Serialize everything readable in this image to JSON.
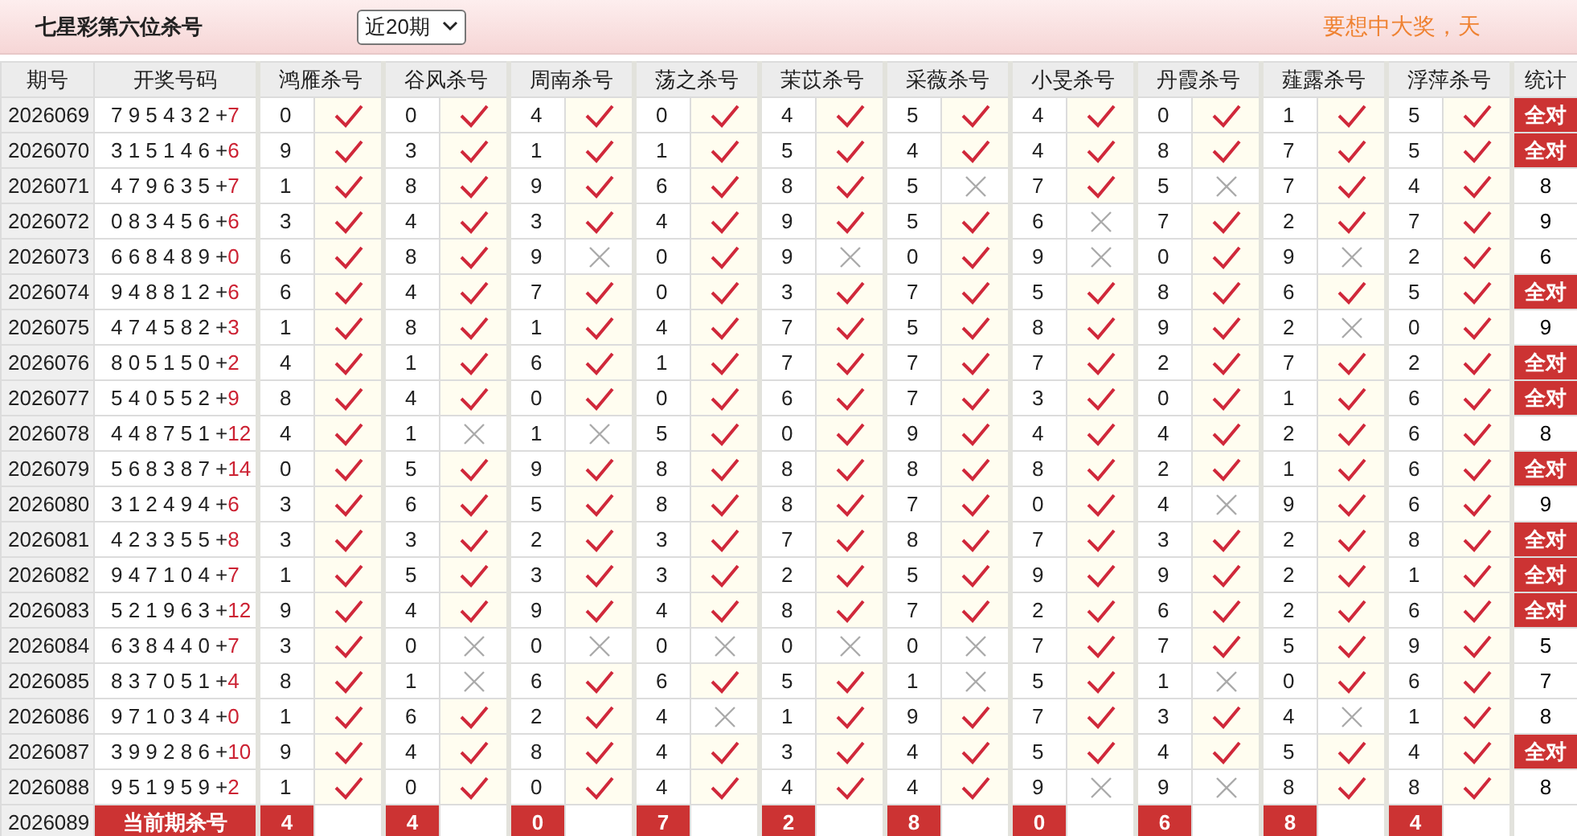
{
  "header": {
    "title": "七星彩第六位杀号",
    "period_select": {
      "value": "近20期"
    },
    "slogan": "要想中大奖，天"
  },
  "table": {
    "columns": [
      "期号",
      "开奖号码",
      "鸿雁杀号",
      "谷风杀号",
      "周南杀号",
      "荡之杀号",
      "茉苡杀号",
      "采薇杀号",
      "小旻杀号",
      "丹霞杀号",
      "薤露杀号",
      "浮萍杀号",
      "统计"
    ],
    "rows": [
      {
        "issue": "2026069",
        "draw": "7 9 5 4 3 2 +",
        "bonus": "7",
        "picks": [
          {
            "num": "0",
            "hit": true
          },
          {
            "num": "0",
            "hit": true
          },
          {
            "num": "4",
            "hit": true
          },
          {
            "num": "0",
            "hit": true
          },
          {
            "num": "4",
            "hit": true
          },
          {
            "num": "5",
            "hit": true
          },
          {
            "num": "4",
            "hit": true
          },
          {
            "num": "0",
            "hit": true
          },
          {
            "num": "1",
            "hit": true
          },
          {
            "num": "5",
            "hit": true
          }
        ],
        "stat": {
          "kind": "all",
          "text": "全对"
        }
      },
      {
        "issue": "2026070",
        "draw": "3 1 5 1 4 6 +",
        "bonus": "6",
        "picks": [
          {
            "num": "9",
            "hit": true
          },
          {
            "num": "3",
            "hit": true
          },
          {
            "num": "1",
            "hit": true
          },
          {
            "num": "1",
            "hit": true
          },
          {
            "num": "5",
            "hit": true
          },
          {
            "num": "4",
            "hit": true
          },
          {
            "num": "4",
            "hit": true
          },
          {
            "num": "8",
            "hit": true
          },
          {
            "num": "7",
            "hit": true
          },
          {
            "num": "5",
            "hit": true
          }
        ],
        "stat": {
          "kind": "all",
          "text": "全对"
        }
      },
      {
        "issue": "2026071",
        "draw": "4 7 9 6 3 5 +",
        "bonus": "7",
        "picks": [
          {
            "num": "1",
            "hit": true
          },
          {
            "num": "8",
            "hit": true
          },
          {
            "num": "9",
            "hit": true
          },
          {
            "num": "6",
            "hit": true
          },
          {
            "num": "8",
            "hit": true
          },
          {
            "num": "5",
            "hit": false
          },
          {
            "num": "7",
            "hit": true
          },
          {
            "num": "5",
            "hit": false
          },
          {
            "num": "7",
            "hit": true
          },
          {
            "num": "4",
            "hit": true
          }
        ],
        "stat": {
          "kind": "count",
          "text": "8"
        }
      },
      {
        "issue": "2026072",
        "draw": "0 8 3 4 5 6 +",
        "bonus": "6",
        "picks": [
          {
            "num": "3",
            "hit": true
          },
          {
            "num": "4",
            "hit": true
          },
          {
            "num": "3",
            "hit": true
          },
          {
            "num": "4",
            "hit": true
          },
          {
            "num": "9",
            "hit": true
          },
          {
            "num": "5",
            "hit": true
          },
          {
            "num": "6",
            "hit": false
          },
          {
            "num": "7",
            "hit": true
          },
          {
            "num": "2",
            "hit": true
          },
          {
            "num": "7",
            "hit": true
          }
        ],
        "stat": {
          "kind": "count",
          "text": "9"
        }
      },
      {
        "issue": "2026073",
        "draw": "6 6 8 4 8 9 +",
        "bonus": "0",
        "picks": [
          {
            "num": "6",
            "hit": true
          },
          {
            "num": "8",
            "hit": true
          },
          {
            "num": "9",
            "hit": false
          },
          {
            "num": "0",
            "hit": true
          },
          {
            "num": "9",
            "hit": false
          },
          {
            "num": "0",
            "hit": true
          },
          {
            "num": "9",
            "hit": false
          },
          {
            "num": "0",
            "hit": true
          },
          {
            "num": "9",
            "hit": false
          },
          {
            "num": "2",
            "hit": true
          }
        ],
        "stat": {
          "kind": "count",
          "text": "6"
        }
      },
      {
        "issue": "2026074",
        "draw": "9 4 8 8 1 2 +",
        "bonus": "6",
        "picks": [
          {
            "num": "6",
            "hit": true
          },
          {
            "num": "4",
            "hit": true
          },
          {
            "num": "7",
            "hit": true
          },
          {
            "num": "0",
            "hit": true
          },
          {
            "num": "3",
            "hit": true
          },
          {
            "num": "7",
            "hit": true
          },
          {
            "num": "5",
            "hit": true
          },
          {
            "num": "8",
            "hit": true
          },
          {
            "num": "6",
            "hit": true
          },
          {
            "num": "5",
            "hit": true
          }
        ],
        "stat": {
          "kind": "all",
          "text": "全对"
        }
      },
      {
        "issue": "2026075",
        "draw": "4 7 4 5 8 2 +",
        "bonus": "3",
        "picks": [
          {
            "num": "1",
            "hit": true
          },
          {
            "num": "8",
            "hit": true
          },
          {
            "num": "1",
            "hit": true
          },
          {
            "num": "4",
            "hit": true
          },
          {
            "num": "7",
            "hit": true
          },
          {
            "num": "5",
            "hit": true
          },
          {
            "num": "8",
            "hit": true
          },
          {
            "num": "9",
            "hit": true
          },
          {
            "num": "2",
            "hit": false
          },
          {
            "num": "0",
            "hit": true
          }
        ],
        "stat": {
          "kind": "count",
          "text": "9"
        }
      },
      {
        "issue": "2026076",
        "draw": "8 0 5 1 5 0 +",
        "bonus": "2",
        "picks": [
          {
            "num": "4",
            "hit": true
          },
          {
            "num": "1",
            "hit": true
          },
          {
            "num": "6",
            "hit": true
          },
          {
            "num": "1",
            "hit": true
          },
          {
            "num": "7",
            "hit": true
          },
          {
            "num": "7",
            "hit": true
          },
          {
            "num": "7",
            "hit": true
          },
          {
            "num": "2",
            "hit": true
          },
          {
            "num": "7",
            "hit": true
          },
          {
            "num": "2",
            "hit": true
          }
        ],
        "stat": {
          "kind": "all",
          "text": "全对"
        }
      },
      {
        "issue": "2026077",
        "draw": "5 4 0 5 5 2 +",
        "bonus": "9",
        "picks": [
          {
            "num": "8",
            "hit": true
          },
          {
            "num": "4",
            "hit": true
          },
          {
            "num": "0",
            "hit": true
          },
          {
            "num": "0",
            "hit": true
          },
          {
            "num": "6",
            "hit": true
          },
          {
            "num": "7",
            "hit": true
          },
          {
            "num": "3",
            "hit": true
          },
          {
            "num": "0",
            "hit": true
          },
          {
            "num": "1",
            "hit": true
          },
          {
            "num": "6",
            "hit": true
          }
        ],
        "stat": {
          "kind": "all",
          "text": "全对"
        }
      },
      {
        "issue": "2026078",
        "draw": "4 4 8 7 5 1 +",
        "bonus": "12",
        "picks": [
          {
            "num": "4",
            "hit": true
          },
          {
            "num": "1",
            "hit": false
          },
          {
            "num": "1",
            "hit": false
          },
          {
            "num": "5",
            "hit": true
          },
          {
            "num": "0",
            "hit": true
          },
          {
            "num": "9",
            "hit": true
          },
          {
            "num": "4",
            "hit": true
          },
          {
            "num": "4",
            "hit": true
          },
          {
            "num": "2",
            "hit": true
          },
          {
            "num": "6",
            "hit": true
          }
        ],
        "stat": {
          "kind": "count",
          "text": "8"
        }
      },
      {
        "issue": "2026079",
        "draw": "5 6 8 3 8 7 +",
        "bonus": "14",
        "picks": [
          {
            "num": "0",
            "hit": true
          },
          {
            "num": "5",
            "hit": true
          },
          {
            "num": "9",
            "hit": true
          },
          {
            "num": "8",
            "hit": true
          },
          {
            "num": "8",
            "hit": true
          },
          {
            "num": "8",
            "hit": true
          },
          {
            "num": "8",
            "hit": true
          },
          {
            "num": "2",
            "hit": true
          },
          {
            "num": "1",
            "hit": true
          },
          {
            "num": "6",
            "hit": true
          }
        ],
        "stat": {
          "kind": "all",
          "text": "全对"
        }
      },
      {
        "issue": "2026080",
        "draw": "3 1 2 4 9 4 +",
        "bonus": "6",
        "picks": [
          {
            "num": "3",
            "hit": true
          },
          {
            "num": "6",
            "hit": true
          },
          {
            "num": "5",
            "hit": true
          },
          {
            "num": "8",
            "hit": true
          },
          {
            "num": "8",
            "hit": true
          },
          {
            "num": "7",
            "hit": true
          },
          {
            "num": "0",
            "hit": true
          },
          {
            "num": "4",
            "hit": false
          },
          {
            "num": "9",
            "hit": true
          },
          {
            "num": "6",
            "hit": true
          }
        ],
        "stat": {
          "kind": "count",
          "text": "9"
        }
      },
      {
        "issue": "2026081",
        "draw": "4 2 3 3 5 5 +",
        "bonus": "8",
        "picks": [
          {
            "num": "3",
            "hit": true
          },
          {
            "num": "3",
            "hit": true
          },
          {
            "num": "2",
            "hit": true
          },
          {
            "num": "3",
            "hit": true
          },
          {
            "num": "7",
            "hit": true
          },
          {
            "num": "8",
            "hit": true
          },
          {
            "num": "7",
            "hit": true
          },
          {
            "num": "3",
            "hit": true
          },
          {
            "num": "2",
            "hit": true
          },
          {
            "num": "8",
            "hit": true
          }
        ],
        "stat": {
          "kind": "all",
          "text": "全对"
        }
      },
      {
        "issue": "2026082",
        "draw": "9 4 7 1 0 4 +",
        "bonus": "7",
        "picks": [
          {
            "num": "1",
            "hit": true
          },
          {
            "num": "5",
            "hit": true
          },
          {
            "num": "3",
            "hit": true
          },
          {
            "num": "3",
            "hit": true
          },
          {
            "num": "2",
            "hit": true
          },
          {
            "num": "5",
            "hit": true
          },
          {
            "num": "9",
            "hit": true
          },
          {
            "num": "9",
            "hit": true
          },
          {
            "num": "2",
            "hit": true
          },
          {
            "num": "1",
            "hit": true
          }
        ],
        "stat": {
          "kind": "all",
          "text": "全对"
        }
      },
      {
        "issue": "2026083",
        "draw": "5 2 1 9 6 3 +",
        "bonus": "12",
        "picks": [
          {
            "num": "9",
            "hit": true
          },
          {
            "num": "4",
            "hit": true
          },
          {
            "num": "9",
            "hit": true
          },
          {
            "num": "4",
            "hit": true
          },
          {
            "num": "8",
            "hit": true
          },
          {
            "num": "7",
            "hit": true
          },
          {
            "num": "2",
            "hit": true
          },
          {
            "num": "6",
            "hit": true
          },
          {
            "num": "2",
            "hit": true
          },
          {
            "num": "6",
            "hit": true
          }
        ],
        "stat": {
          "kind": "all",
          "text": "全对"
        }
      },
      {
        "issue": "2026084",
        "draw": "6 3 8 4 4 0 +",
        "bonus": "7",
        "picks": [
          {
            "num": "3",
            "hit": true
          },
          {
            "num": "0",
            "hit": false
          },
          {
            "num": "0",
            "hit": false
          },
          {
            "num": "0",
            "hit": false
          },
          {
            "num": "0",
            "hit": false
          },
          {
            "num": "0",
            "hit": false
          },
          {
            "num": "7",
            "hit": true
          },
          {
            "num": "7",
            "hit": true
          },
          {
            "num": "5",
            "hit": true
          },
          {
            "num": "9",
            "hit": true
          }
        ],
        "stat": {
          "kind": "count",
          "text": "5"
        }
      },
      {
        "issue": "2026085",
        "draw": "8 3 7 0 5 1 +",
        "bonus": "4",
        "picks": [
          {
            "num": "8",
            "hit": true
          },
          {
            "num": "1",
            "hit": false
          },
          {
            "num": "6",
            "hit": true
          },
          {
            "num": "6",
            "hit": true
          },
          {
            "num": "5",
            "hit": true
          },
          {
            "num": "1",
            "hit": false
          },
          {
            "num": "5",
            "hit": true
          },
          {
            "num": "1",
            "hit": false
          },
          {
            "num": "0",
            "hit": true
          },
          {
            "num": "6",
            "hit": true
          }
        ],
        "stat": {
          "kind": "count",
          "text": "7"
        }
      },
      {
        "issue": "2026086",
        "draw": "9 7 1 0 3 4 +",
        "bonus": "0",
        "picks": [
          {
            "num": "1",
            "hit": true
          },
          {
            "num": "6",
            "hit": true
          },
          {
            "num": "2",
            "hit": true
          },
          {
            "num": "4",
            "hit": false
          },
          {
            "num": "1",
            "hit": true
          },
          {
            "num": "9",
            "hit": true
          },
          {
            "num": "7",
            "hit": true
          },
          {
            "num": "3",
            "hit": true
          },
          {
            "num": "4",
            "hit": false
          },
          {
            "num": "1",
            "hit": true
          }
        ],
        "stat": {
          "kind": "count",
          "text": "8"
        }
      },
      {
        "issue": "2026087",
        "draw": "3 9 9 2 8 6 +",
        "bonus": "10",
        "picks": [
          {
            "num": "9",
            "hit": true
          },
          {
            "num": "4",
            "hit": true
          },
          {
            "num": "8",
            "hit": true
          },
          {
            "num": "4",
            "hit": true
          },
          {
            "num": "3",
            "hit": true
          },
          {
            "num": "4",
            "hit": true
          },
          {
            "num": "5",
            "hit": true
          },
          {
            "num": "4",
            "hit": true
          },
          {
            "num": "5",
            "hit": true
          },
          {
            "num": "4",
            "hit": true
          }
        ],
        "stat": {
          "kind": "all",
          "text": "全对"
        }
      },
      {
        "issue": "2026088",
        "draw": "9 5 1 9 5 9 +",
        "bonus": "2",
        "picks": [
          {
            "num": "1",
            "hit": true
          },
          {
            "num": "0",
            "hit": true
          },
          {
            "num": "0",
            "hit": true
          },
          {
            "num": "4",
            "hit": true
          },
          {
            "num": "4",
            "hit": true
          },
          {
            "num": "4",
            "hit": true
          },
          {
            "num": "9",
            "hit": false
          },
          {
            "num": "9",
            "hit": false
          },
          {
            "num": "8",
            "hit": true
          },
          {
            "num": "8",
            "hit": true
          }
        ],
        "stat": {
          "kind": "count",
          "text": "8"
        }
      }
    ],
    "current": {
      "issue": "2026089",
      "label": "当前期杀号",
      "picks": [
        "4",
        "4",
        "0",
        "7",
        "2",
        "8",
        "0",
        "6",
        "8",
        "4"
      ]
    }
  }
}
